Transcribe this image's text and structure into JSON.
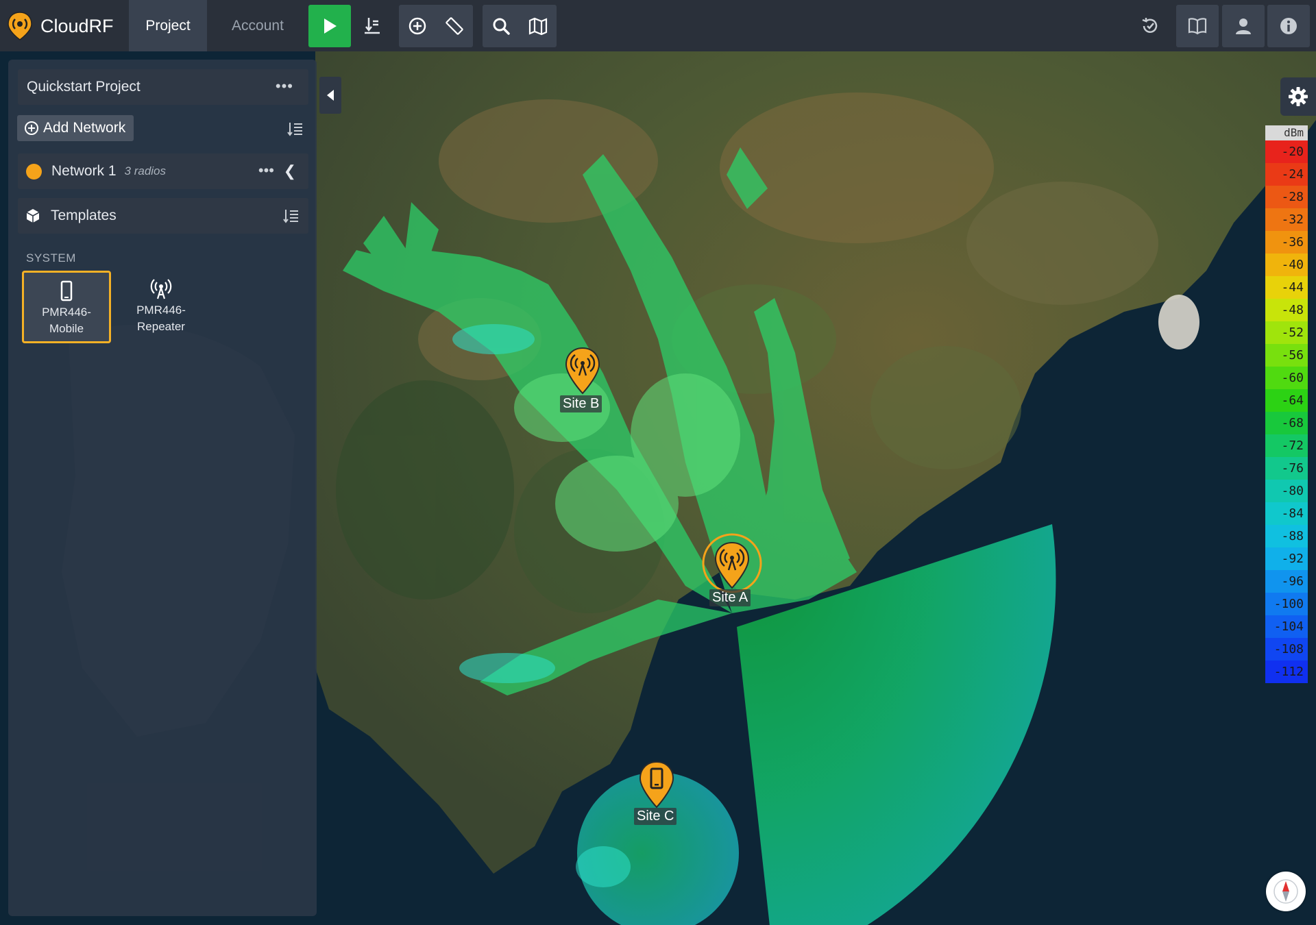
{
  "app": {
    "name": "CloudRF",
    "logo_icon": "cloudrf-logo-icon"
  },
  "nav": {
    "tabs": [
      {
        "label": "Project",
        "active": true
      },
      {
        "label": "Account",
        "active": false
      }
    ]
  },
  "toolbar": {
    "run_icon": "play-icon",
    "tools": [
      "import-icon",
      "add-site-icon",
      "ruler-icon",
      "search-icon",
      "map-layers-icon"
    ],
    "right": [
      "history-icon",
      "book-icon",
      "user-icon",
      "info-icon"
    ]
  },
  "panel": {
    "project_name": "Quickstart Project",
    "menu_icon": "more-icon",
    "add_network_label": "Add Network",
    "network": {
      "name": "Network 1",
      "subtitle": "3 radios",
      "color": "#f5a31a"
    },
    "templates_label": "Templates",
    "system_heading": "SYSTEM",
    "templates": [
      {
        "line1": "PMR446-",
        "line2": "Mobile",
        "icon": "mobile-phone-icon",
        "selected": true
      },
      {
        "line1": "PMR446-",
        "line2": "Repeater",
        "icon": "antenna-icon",
        "selected": false
      }
    ]
  },
  "map": {
    "sites": [
      {
        "label": "Site B",
        "icon": "antenna-icon"
      },
      {
        "label": "Site A",
        "icon": "antenna-icon"
      },
      {
        "label": "Site C",
        "icon": "mobile-phone-icon"
      }
    ]
  },
  "legend": {
    "unit": "dBm",
    "values": [
      "-20",
      "-24",
      "-28",
      "-32",
      "-36",
      "-40",
      "-44",
      "-48",
      "-52",
      "-56",
      "-60",
      "-64",
      "-68",
      "-72",
      "-76",
      "-80",
      "-84",
      "-88",
      "-92",
      "-96",
      "-100",
      "-104",
      "-108",
      "-112"
    ],
    "colors": [
      "#e8231c",
      "#ea3a16",
      "#ec5814",
      "#ee7512",
      "#f0930f",
      "#f0b40c",
      "#e8d20a",
      "#c8e40a",
      "#a0e40c",
      "#78e00e",
      "#50da10",
      "#2cd214",
      "#18c83c",
      "#14c864",
      "#12c88c",
      "#10c8b0",
      "#10c8cc",
      "#10c0e0",
      "#10b0ea",
      "#1094ee",
      "#107af0",
      "#1060f2",
      "#1046f2",
      "#1030f0"
    ]
  }
}
